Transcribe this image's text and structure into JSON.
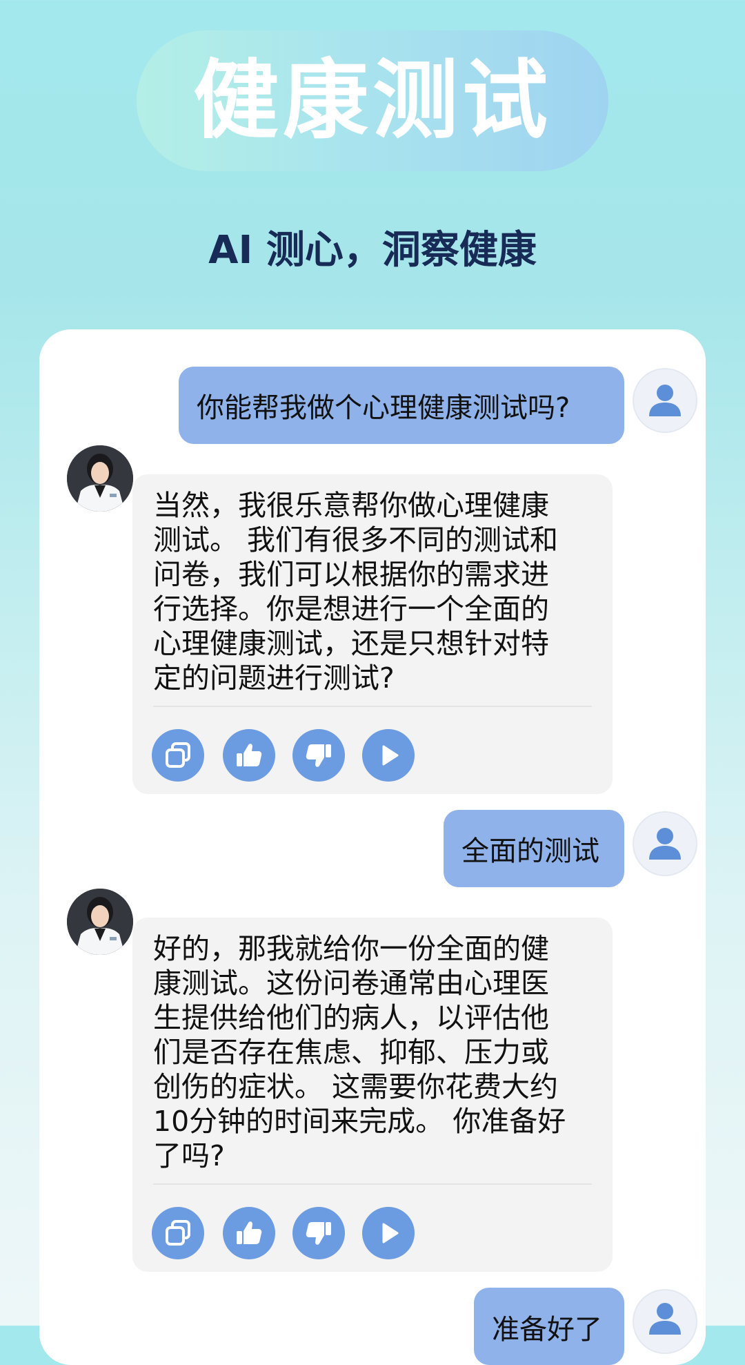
{
  "header": {
    "title": "健康测试",
    "subtitle": "AI 测心，洞察健康"
  },
  "messages": [
    {
      "role": "user",
      "text": "你能帮我做个心理健康测试吗?"
    },
    {
      "role": "bot",
      "text": "当然，我很乐意帮你做心理健康\n测试。 我们有很多不同的测试和\n问卷，我们可以根据你的需求进\n行选择。你是想进行一个全面的\n心理健康测试，还是只想针对特\n定的问题进行测试?"
    },
    {
      "role": "user",
      "text": "全面的测试"
    },
    {
      "role": "bot",
      "text": "好的，那我就给你一份全面的健\n康测试。这份问卷通常由心理医\n生提供给他们的病人，以评估他\n们是否存在焦虑、抑郁、压力或\n创伤的症状。 这需要你花费大约\n10分钟的时间来完成。 你准备好\n了吗?"
    },
    {
      "role": "user",
      "text": "准备好了"
    }
  ],
  "icons": {
    "user_avatar": "person-icon",
    "doctor_avatar": "doctor-photo",
    "copy": "copy-icon",
    "like": "thumbs-up-icon",
    "dislike": "thumbs-down-icon",
    "play": "play-icon"
  },
  "colors": {
    "user_bubble": "#8fb2ea",
    "bot_bubble": "#f3f3f3",
    "action_button": "#6b9be0",
    "subtitle": "#182a56"
  }
}
